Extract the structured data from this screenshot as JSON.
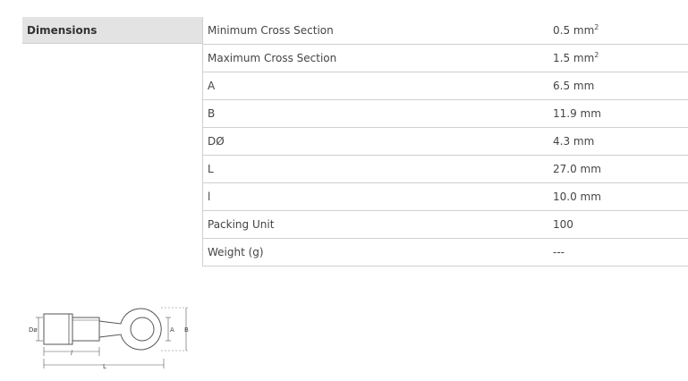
{
  "section": {
    "title": "Dimensions"
  },
  "rows": [
    {
      "label": "Minimum Cross Section",
      "value": "0.5 mm",
      "sup": "2"
    },
    {
      "label": "Maximum Cross Section",
      "value": "1.5 mm",
      "sup": "2"
    },
    {
      "label": "A",
      "value": "6.5 mm",
      "sup": ""
    },
    {
      "label": "B",
      "value": "11.9 mm",
      "sup": ""
    },
    {
      "label": "DØ",
      "value": "4.3 mm",
      "sup": ""
    },
    {
      "label": "L",
      "value": "27.0 mm",
      "sup": ""
    },
    {
      "label": "l",
      "value": "10.0 mm",
      "sup": ""
    },
    {
      "label": "Packing Unit",
      "value": "100",
      "sup": ""
    },
    {
      "label": "Weight (g)",
      "value": "---",
      "sup": ""
    }
  ],
  "drawing": {
    "label_d": "Dø",
    "label_a": "A",
    "label_b": "B",
    "label_l_small": "l",
    "label_l": "L"
  },
  "colors": {
    "header_bg": "#e3e3e3",
    "border": "#d0d0d0",
    "text": "#444444"
  }
}
